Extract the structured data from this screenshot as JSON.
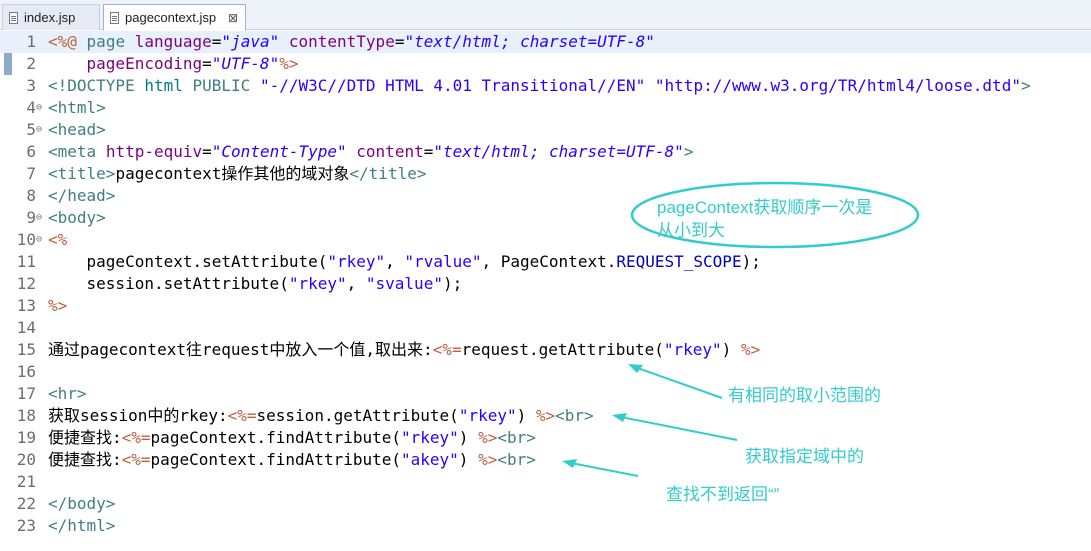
{
  "tabs": [
    {
      "label": "index.jsp",
      "active": false
    },
    {
      "label": "pagecontext.jsp",
      "active": true,
      "close": "⊠"
    }
  ],
  "lines": [
    {
      "n": "1",
      "fold": "",
      "html": "<span class='d'>&lt;%@</span> <span class='t'>page</span> <span class='a'>language</span>=<span class='s'>\"java\"</span> <span class='a'>contentType</span>=<span class='s'>\"text/html; charset=UTF-8\"</span>"
    },
    {
      "n": "2",
      "fold": "",
      "html": "    <span class='a'>pageEncoding</span>=<span class='s'>\"UTF-8\"</span><span class='d'>%&gt;</span>"
    },
    {
      "n": "3",
      "fold": "",
      "html": "<span class='t'>&lt;!DOCTYPE</span> <span class='dt'>html</span> <span class='t'>PUBLIC</span> <span class='j'>\"-//W3C//DTD HTML 4.01 Transitional//EN\"</span> <span class='j'>\"http://www.w3.org/TR/html4/loose.dtd\"</span><span class='t'>&gt;</span>"
    },
    {
      "n": "4",
      "fold": "⊖",
      "html": "<span class='t'>&lt;html&gt;</span>"
    },
    {
      "n": "5",
      "fold": "⊖",
      "html": "<span class='t'>&lt;head&gt;</span>"
    },
    {
      "n": "6",
      "fold": "",
      "html": "<span class='t'>&lt;meta</span> <span class='a'>http-equiv</span>=<span class='s'>\"Content-Type\"</span> <span class='a'>content</span>=<span class='s'>\"text/html; charset=UTF-8\"</span><span class='t'>&gt;</span>"
    },
    {
      "n": "7",
      "fold": "",
      "html": "<span class='t'>&lt;title&gt;</span>pagecontext操作其他的域对象<span class='t'>&lt;/title&gt;</span>"
    },
    {
      "n": "8",
      "fold": "",
      "html": "<span class='t'>&lt;/head&gt;</span>"
    },
    {
      "n": "9",
      "fold": "⊖",
      "html": "<span class='t'>&lt;body&gt;</span>"
    },
    {
      "n": "10",
      "fold": "⊖",
      "html": "<span class='d'>&lt;%</span>"
    },
    {
      "n": "11",
      "fold": "",
      "html": "    pageContext.setAttribute(<span class='j'>\"rkey\"</span>, <span class='j'>\"rvalue\"</span>, PageContext.<span class='k'>REQUEST_SCOPE</span>);"
    },
    {
      "n": "12",
      "fold": "",
      "html": "    session.setAttribute(<span class='j'>\"rkey\"</span>, <span class='j'>\"svalue\"</span>);"
    },
    {
      "n": "13",
      "fold": "",
      "html": "<span class='d'>%&gt;</span>"
    },
    {
      "n": "14",
      "fold": "",
      "html": ""
    },
    {
      "n": "15",
      "fold": "",
      "html": "通过pagecontext往request中放入一个值,取出来:<span class='d'>&lt;%=</span>request.getAttribute(<span class='j'>\"rkey\"</span>) <span class='d'>%&gt;</span>"
    },
    {
      "n": "16",
      "fold": "",
      "html": ""
    },
    {
      "n": "17",
      "fold": "",
      "html": "<span class='t'>&lt;hr&gt;</span>"
    },
    {
      "n": "18",
      "fold": "",
      "html": "获取session中的rkey:<span class='d'>&lt;%=</span>session.getAttribute(<span class='j'>\"rkey\"</span>) <span class='d'>%&gt;</span><span class='t'>&lt;br&gt;</span>"
    },
    {
      "n": "19",
      "fold": "",
      "html": "便捷查找:<span class='d'>&lt;%=</span>pageContext.findAttribute(<span class='j'>\"rkey\"</span>) <span class='d'>%&gt;</span><span class='t'>&lt;br&gt;</span>"
    },
    {
      "n": "20",
      "fold": "",
      "html": "便捷查找:<span class='d'>&lt;%=</span>pageContext.findAttribute(<span class='j'>\"akey\"</span>) <span class='d'>%&gt;</span><span class='t'>&lt;br&gt;</span>"
    },
    {
      "n": "21",
      "fold": "",
      "html": ""
    },
    {
      "n": "22",
      "fold": "",
      "html": "<span class='t'>&lt;/body&gt;</span>"
    },
    {
      "n": "23",
      "fold": "",
      "html": "<span class='t'>&lt;/html&gt;</span>"
    }
  ],
  "annotations": {
    "ellipse_note_line1": "pageContext获取顺序一次是",
    "ellipse_note_line2": "从小到大",
    "note_same_range": "有相同的取小范围的",
    "note_specific_scope": "获取指定域中的",
    "note_not_found": "查找不到返回“”"
  },
  "colors": {
    "annotation": "#33cccc",
    "tag": "#3f7f7f",
    "attribute": "#7f007f",
    "string": "#2a00ff",
    "jsp_delim": "#bf5f3f"
  }
}
